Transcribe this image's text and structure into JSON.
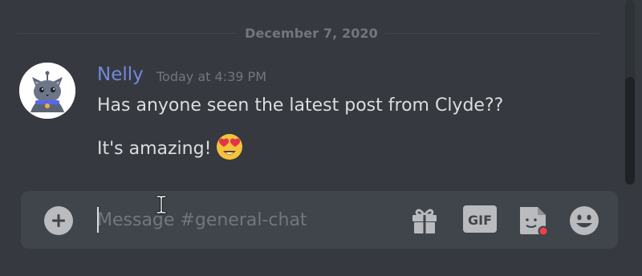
{
  "date_divider": {
    "label": "December 7, 2020"
  },
  "message": {
    "author": "Nelly",
    "timestamp": "Today at 4:39 PM",
    "lines": [
      "Has anyone seen the latest post from Clyde??",
      "It's amazing!"
    ],
    "emoji": "heart-eyes-emoji",
    "avatar": "cat-avatar",
    "colors": {
      "author": "#7289da",
      "text": "#dcddde",
      "muted": "#72767d"
    }
  },
  "composer": {
    "placeholder": "Message #general-chat",
    "value": "",
    "buttons": {
      "add": "plus-circle-icon",
      "gift": "gift-icon",
      "gif": "GIF",
      "sticker": "sticker-icon",
      "emoji": "smile-icon"
    },
    "sticker_badge_color": "#ed4245"
  },
  "theme": {
    "background": "#36393f",
    "composer_bg": "#40444b",
    "icon": "#b9bbbe"
  }
}
